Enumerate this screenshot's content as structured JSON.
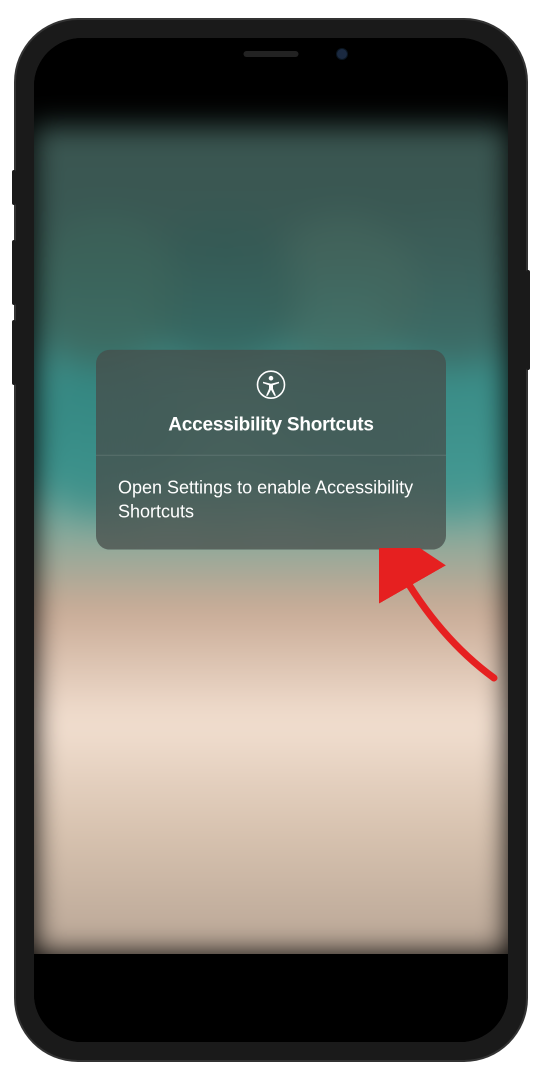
{
  "modal": {
    "title": "Accessibility Shortcuts",
    "body_text": "Open Settings to enable Accessibility Shortcuts",
    "icon_name": "accessibility-icon"
  },
  "annotation": {
    "type": "arrow",
    "color": "#e62020"
  }
}
